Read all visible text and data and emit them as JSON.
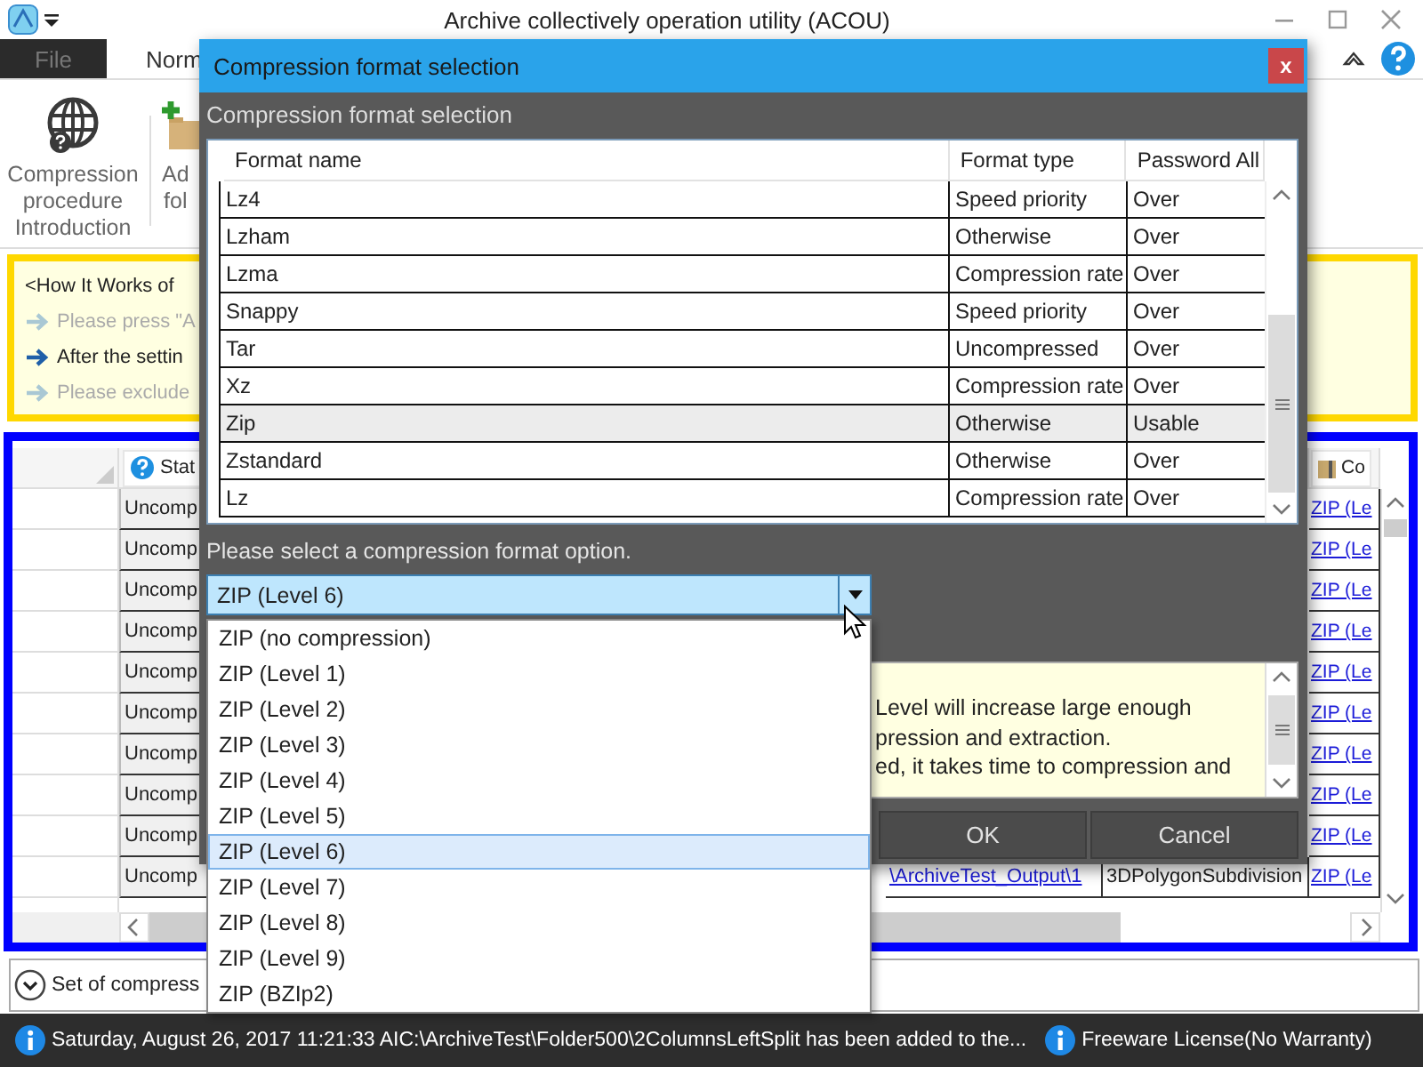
{
  "window": {
    "title": "Archive collectively operation utility (ACOU)"
  },
  "ribbon": {
    "tabs": [
      {
        "label": "File",
        "kind": "menu",
        "selected": false
      },
      {
        "label": "Norm",
        "kind": "tab",
        "selected": true
      }
    ],
    "buttons": [
      {
        "lines": [
          "Compression",
          "procedure",
          "Introduction"
        ]
      },
      {
        "lines": [
          "Ad",
          "fol"
        ]
      }
    ]
  },
  "guide": {
    "items": [
      {
        "text": "<How It Works of",
        "kind": "heading"
      },
      {
        "text": "Please press \"A",
        "kind": "step",
        "active": false
      },
      {
        "text": "After the settin",
        "kind": "step",
        "active": true
      },
      {
        "text": "Please exclude",
        "kind": "step",
        "active": false
      }
    ]
  },
  "grid": {
    "status_header": "Stat",
    "compression_header": "Co",
    "rows": [
      {
        "status": "Uncomp",
        "compression": "ZIP (Le"
      },
      {
        "status": "Uncomp",
        "compression": "ZIP (Le"
      },
      {
        "status": "Uncomp",
        "compression": "ZIP (Le"
      },
      {
        "status": "Uncomp",
        "compression": "ZIP (Le"
      },
      {
        "status": "Uncomp",
        "compression": "ZIP (Le"
      },
      {
        "status": "Uncomp",
        "compression": "ZIP (Le"
      },
      {
        "status": "Uncomp",
        "compression": "ZIP (Le"
      },
      {
        "status": "Uncomp",
        "compression": "ZIP (Le"
      },
      {
        "status": "Uncomp",
        "compression": "ZIP (Le"
      },
      {
        "status": "Uncomp",
        "path": "\\ArchiveTest_Output\\1",
        "type": "3DPolygonSubdivision",
        "compression": "ZIP (Le"
      }
    ]
  },
  "options_bar": {
    "label": "Set of compress",
    "expanded": false
  },
  "dialog": {
    "title": "Compression format selection",
    "close": "x",
    "heading": "Compression format selection",
    "columns": [
      "Format name",
      "Format type",
      "Password All"
    ],
    "formats": [
      {
        "name": "Lz4",
        "type": "Speed priority",
        "password": "Over",
        "selected": false
      },
      {
        "name": "Lzham",
        "type": "Otherwise",
        "password": "Over",
        "selected": false
      },
      {
        "name": "Lzma",
        "type": "Compression rate",
        "password": "Over",
        "selected": false
      },
      {
        "name": "Snappy",
        "type": "Speed priority",
        "password": "Over",
        "selected": false
      },
      {
        "name": "Tar",
        "type": "Uncompressed",
        "password": "Over",
        "selected": false
      },
      {
        "name": "Xz",
        "type": "Compression rate",
        "password": "Over",
        "selected": false
      },
      {
        "name": "Zip",
        "type": "Otherwise",
        "password": "Usable",
        "selected": true
      },
      {
        "name": "Zstandard",
        "type": "Otherwise",
        "password": "Over",
        "selected": false
      },
      {
        "name": "Lz",
        "type": "Compression rate",
        "password": "Over",
        "selected": false
      }
    ],
    "prompt": "Please select a compression format option.",
    "combo": {
      "value": "ZIP (Level 6)",
      "open": true
    },
    "options": [
      {
        "label": "ZIP (no compression)",
        "selected": false
      },
      {
        "label": "ZIP (Level 1)",
        "selected": false
      },
      {
        "label": "ZIP (Level 2)",
        "selected": false
      },
      {
        "label": "ZIP (Level 3)",
        "selected": false
      },
      {
        "label": "ZIP (Level 4)",
        "selected": false
      },
      {
        "label": "ZIP (Level 5)",
        "selected": false
      },
      {
        "label": "ZIP (Level 6)",
        "selected": true
      },
      {
        "label": "ZIP (Level 7)",
        "selected": false
      },
      {
        "label": "ZIP (Level 8)",
        "selected": false
      },
      {
        "label": "ZIP (Level 9)",
        "selected": false
      },
      {
        "label": "ZIP (BZIp2)",
        "selected": false
      }
    ],
    "description": [
      "Level will increase large enough",
      "pression and extraction.",
      "ed, it takes time to compression and"
    ],
    "buttons": [
      "OK",
      "Cancel"
    ]
  },
  "status_bar": {
    "time": "Saturday, August 26, 2017 11:21:33 AI",
    "message": "C:\\ArchiveTest\\Folder500\\2ColumnsLeftSplit has been added to the...",
    "license": "Freeware License(No Warranty)"
  }
}
